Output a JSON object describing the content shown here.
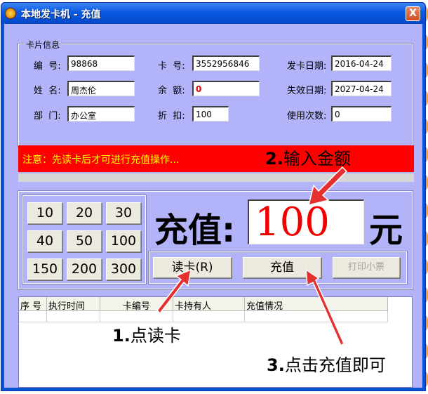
{
  "window": {
    "title": "本地发卡机 - 充值",
    "close_glyph": "X"
  },
  "card_info": {
    "legend": "卡片信息",
    "fields": [
      {
        "label": "编  号:",
        "value": "98868"
      },
      {
        "label": "卡  号:",
        "value": "3552956846"
      },
      {
        "label": "发卡日期:",
        "value": "2016-04-24"
      },
      {
        "label": "姓  名:",
        "value": "周杰伦"
      },
      {
        "label": "余  额:",
        "value": "0"
      },
      {
        "label": "失效日期:",
        "value": "2027-04-24"
      },
      {
        "label": "部  门:",
        "value": "办公室"
      },
      {
        "label": "折  扣:",
        "value": "100"
      },
      {
        "label": "使用次数:",
        "value": "0"
      }
    ]
  },
  "notice": "注意：先读卡后才可进行充值操作...",
  "amount_buttons": [
    "10",
    "20",
    "30",
    "40",
    "50",
    "100",
    "150",
    "200",
    "300"
  ],
  "recharge": {
    "label": "充值:",
    "value": "100",
    "unit": "元"
  },
  "actions": {
    "read_card": "读卡(R)",
    "recharge": "充值",
    "print_receipt": "打印小票"
  },
  "table": {
    "columns": [
      "序 号",
      "执行时间",
      "卡编号",
      "卡持有人",
      "充值情况"
    ]
  },
  "annotations": {
    "step1": {
      "num": "1.",
      "text": "点读卡"
    },
    "step2": {
      "num": "2.",
      "text": "输入金额"
    },
    "step3": {
      "num": "3.",
      "text": "点击充值即可"
    }
  },
  "colors": {
    "accent_red": "#ff0000",
    "panel": "#b3b3f9",
    "titlebar": "#0a59e0"
  }
}
